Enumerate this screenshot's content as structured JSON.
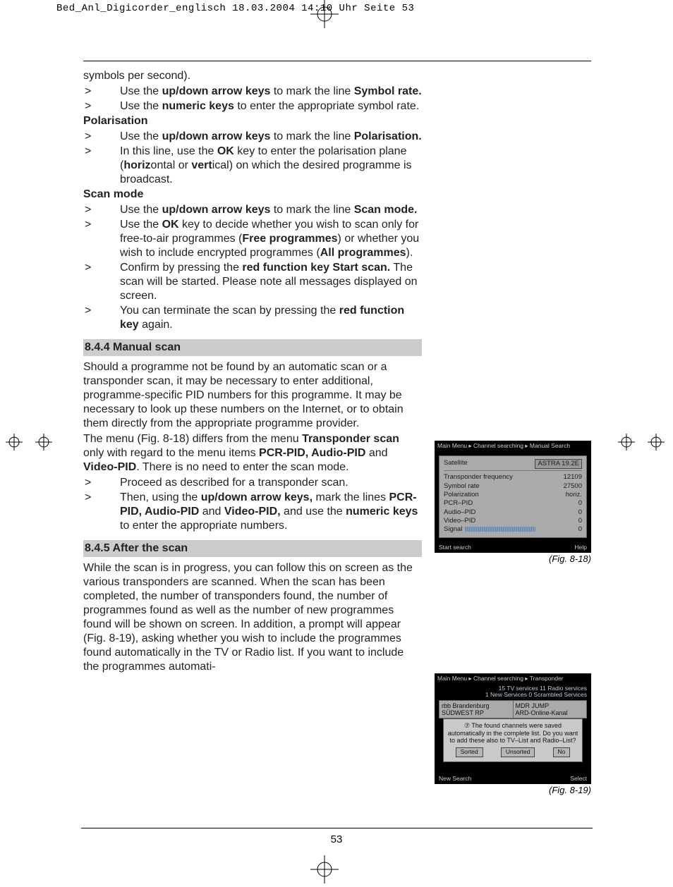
{
  "slug": "Bed_Anl_Digicorder_englisch  18.03.2004  14:10 Uhr  Seite 53",
  "page_number": "53",
  "intro_line": "symbols per second).",
  "bullets_symbolrate": [
    {
      "mark": ">",
      "html": "Use the <b>up/down arrow keys</b> to mark the line <b>Symbol rate.</b>"
    },
    {
      "mark": ">",
      "html": "Use the <b>numeric keys</b> to enter the appropriate symbol rate."
    }
  ],
  "heading_polarisation": "Polarisation",
  "bullets_polarisation": [
    {
      "mark": ">",
      "html": "Use the <b>up/down arrow keys</b> to mark the line <b>Polarisation.</b>"
    },
    {
      "mark": ">",
      "html": "In this line, use the <b>OK</b> key to enter the polarisation plane (<b>horiz</b>ontal or <b>vert</b>ical) on which the desired programme is broadcast."
    }
  ],
  "heading_scanmode": "Scan mode",
  "bullets_scanmode": [
    {
      "mark": ">",
      "html": "Use the <b>up/down arrow keys</b> to mark the line <b>Scan mode.</b>"
    },
    {
      "mark": ">",
      "html": "Use the <b>OK</b> key to decide whether you wish to scan only for free-to-air programmes (<b>Free programmes</b>) or whether you wish to include encrypted programmes (<b>All programmes</b>)."
    },
    {
      "mark": ">",
      "html": "Confirm by pressing the <b>red function key Start scan.</b> The scan will be started. Please note all messages displayed on screen."
    },
    {
      "mark": ">",
      "html": "You can terminate the scan by pressing the <b>red function key</b> again."
    }
  ],
  "section_844": "8.4.4 Manual scan",
  "para_844a": "Should a programme not be found by an automatic scan or a transponder scan, it may be necessary to enter additional, programme-specific PID numbers for this programme. It may be necessary to look up these numbers on the Internet, or to obtain them directly from the appropriate programme provider.",
  "para_844b_html": "The menu (Fig. 8-18) differs from the menu <b>Transponder scan</b> only with regard to the menu items <b>PCR-PID, Audio-PID</b> and <b>Video-PID</b>. There is no need to enter the scan mode.",
  "bullets_844": [
    {
      "mark": ">",
      "html": "Proceed as described for a transponder scan."
    },
    {
      "mark": ">",
      "html": "Then, using the <b>up/down arrow keys,</b> mark the lines <b>PCR-PID, Audio-PID</b> and <b>Video-PID,</b> and use the <b>numeric keys</b> to enter the appropriate numbers."
    }
  ],
  "section_845": "8.4.5 After the scan",
  "para_845": "While the scan is in progress, you can follow this on screen as the various transponders are scanned. When the scan has been completed, the number of transponders found, the number of programmes found as well as the number of new programmes found will be shown  on screen. In addition, a prompt will appear (Fig. 8-19), asking whether you wish to include the programmes found automatically in the TV or Radio list. If you want to include the programmes automati-",
  "fig18": {
    "caption": "(Fig. 8-18)",
    "breadcrumb": "Main Menu ▸ Channel searching ▸ Manual Search",
    "rows": [
      {
        "label": "Satellite",
        "val": "ASTRA 19.2E",
        "selected": true
      },
      {
        "label": "Transponder frequency",
        "val": "12109"
      },
      {
        "label": "Symbol rate",
        "val": "27500"
      },
      {
        "label": "Polarization",
        "val": "horiz."
      },
      {
        "label": "PCR–PID",
        "val": "0"
      },
      {
        "label": "Audio–PID",
        "val": "0"
      },
      {
        "label": "Video–PID",
        "val": "0"
      },
      {
        "label": "Signal",
        "val": "0",
        "bar": true
      }
    ],
    "footer_left": "Start search",
    "footer_right": "Help"
  },
  "fig19": {
    "caption": "(Fig. 8-19)",
    "breadcrumb": "Main Menu ▸ Channel searching ▸ Transponder",
    "stats_line1": "15 TV services  11 Radio services",
    "stats_line2": "1 New Services   0 Scrambled Services",
    "left_list": [
      "rbb Brandenburg",
      "SÜDWEST RP"
    ],
    "right_list": [
      "MDR JUMP",
      "ARD-Online-Kanal"
    ],
    "dialog_text": "⑦ The found channels were saved automatically in the complete list. Do you want to add these also to TV–List and Radio–List?",
    "buttons": [
      "Sorted",
      "Unsorted",
      "No"
    ],
    "footer_left": "New Search",
    "footer_right": "Select"
  }
}
